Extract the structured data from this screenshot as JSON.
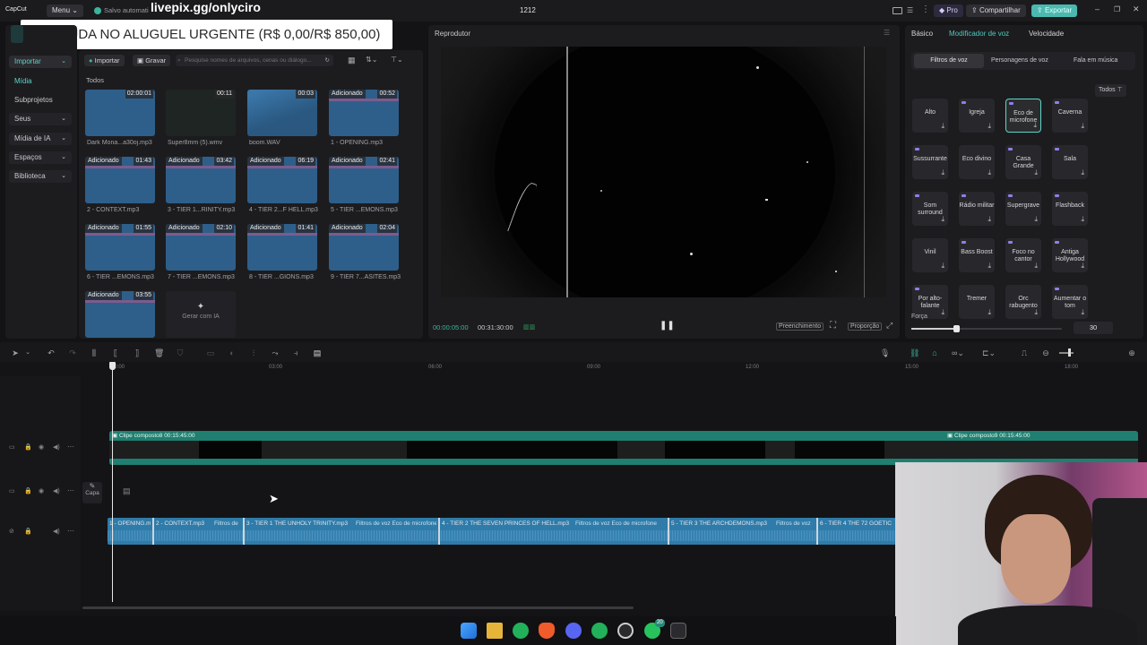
{
  "topbar": {
    "app_name": "CapCut",
    "menu_label": "Menu",
    "save_status": "Salvo automati",
    "project_title": "1212",
    "pro_label": "Pro",
    "share_label": "Compartilhar",
    "export_label": "Exportar"
  },
  "overlay": {
    "url": "livepix.gg/onlyciro",
    "banner": "AJUDA NO ALUGUEL URGENTE (R$ 0,00/R$ 850,00)"
  },
  "sidebar": {
    "items": [
      "Importar",
      "Mídia",
      "Subprojetos",
      "Seus",
      "Mídia de IA",
      "Espaços",
      "Biblioteca"
    ]
  },
  "media": {
    "import_label": "Importar",
    "record_label": "Gravar",
    "search_placeholder": "Pesquise nomes de arquivos, cenas ou diálogo...",
    "all_label": "Todos",
    "items": [
      {
        "name": "Dark Mona...a30oj.mp3",
        "duration": "02:00:01",
        "tag": ""
      },
      {
        "name": "Super8mm (5).wmv",
        "duration": "00:11",
        "tag": ""
      },
      {
        "name": "boom.WAV",
        "duration": "00:03",
        "tag": ""
      },
      {
        "name": "1 - OPENING.mp3",
        "duration": "00:52",
        "tag": "Adicionado"
      },
      {
        "name": "2 - CONTEXT.mp3",
        "duration": "01:43",
        "tag": "Adicionado"
      },
      {
        "name": "3 - TIER 1...RINITY.mp3",
        "duration": "03:42",
        "tag": "Adicionado"
      },
      {
        "name": "4 - TIER 2...F HELL.mp3",
        "duration": "06:19",
        "tag": "Adicionado"
      },
      {
        "name": "5 - TIER ...EMONS.mp3",
        "duration": "02:41",
        "tag": "Adicionado"
      },
      {
        "name": "6 - TIER ...EMONS.mp3",
        "duration": "01:55",
        "tag": "Adicionado"
      },
      {
        "name": "7 - TIER ...EMONS.mp3",
        "duration": "02:10",
        "tag": "Adicionado"
      },
      {
        "name": "8 - TIER ...GIONS.mp3",
        "duration": "01:41",
        "tag": "Adicionado"
      },
      {
        "name": "9 - TIER 7...ASITES.mp3",
        "duration": "02:04",
        "tag": "Adicionado"
      },
      {
        "name": "",
        "duration": "03:55",
        "tag": "Adicionado"
      }
    ],
    "generate_ai_label": "Gerar com IA"
  },
  "player": {
    "title": "Reprodutor",
    "current_time": "00:00:05:00",
    "total_time": "00:31:30:00",
    "fill_label": "Preenchimento",
    "ratio_label": "Proporção"
  },
  "right_panel": {
    "tabs": [
      "Básico",
      "Modificador de voz",
      "Velocidade"
    ],
    "subtabs": [
      "Filtros de voz",
      "Personagens de voz",
      "Fala em música"
    ],
    "filter_label": "Todos",
    "voices": [
      "Alto",
      "Igreja",
      "Eco de microfone",
      "Caverna",
      "Sussurrante",
      "Eco divino",
      "Casa Grande",
      "Sala",
      "Som surround",
      "Rádio militar",
      "Supergrave",
      "Flashback",
      "Vinil",
      "Bass Boost",
      "Foco no cantor",
      "Antiga Hollywood",
      "Por alto-falante",
      "Tremer",
      "Orc rabugento",
      "Aumentar o tom"
    ],
    "strength_label": "Força",
    "strength_value": "30",
    "strength_fraction": 0.3
  },
  "timeline": {
    "ruler": [
      "00:00",
      "03:00",
      "06:00",
      "09:00",
      "12:00",
      "15:00",
      "18:00"
    ],
    "video_clip1": "Clipe composto8  00:15:45:00",
    "video_clip2": "Clipe composto9  00:15:45:00",
    "cover_label": "Capa",
    "audio_clips": [
      "1 - OPENING.m",
      "2 - CONTEXT.mp3",
      "Filtros de",
      "3 - TIER 1 THE UNHOLY TRINITY.mp3",
      "Filtros de voz  Eco de microfone",
      "4 - TIER 2 THE SEVEN PRINCES OF HELL.mp3",
      "Filtros de voz  Eco de microfone",
      "5 - TIER 3 THE ARCHDEMONS.mp3",
      "Filtros de voz",
      "6 - TIER 4 THE 72 GOETIC"
    ]
  },
  "taskbar": {
    "badge_count": "20"
  }
}
